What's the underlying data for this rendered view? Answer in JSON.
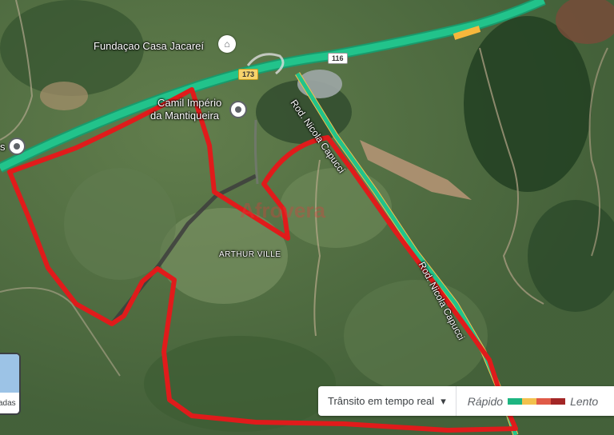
{
  "map": {
    "place_labels": {
      "fundacao": "Fundaçao Casa Jacareí",
      "camil_line1": "Camil Império",
      "camil_line2": "da Mantiqueira",
      "arthur": "ARTHUR VILLE",
      "left_edge": "s"
    },
    "road_labels": {
      "shield_116": "116",
      "shield_173": "173",
      "rod_upper": "Rod. Nicola Capucci",
      "rod_lower": "Rod. Nicola Capucci"
    },
    "watermark": "Afrovera"
  },
  "traffic": {
    "selector_label": "Trânsito em tempo real",
    "dropdown_icon": "▾",
    "fast_label": "Rápido",
    "slow_label": "Lento",
    "colors": [
      "#1db581",
      "#f2c14e",
      "#e05a47",
      "#a32626"
    ]
  },
  "layers": {
    "label": "adas"
  },
  "icons": {
    "pin": "location-pin-icon",
    "museum": "museum-icon"
  },
  "colors": {
    "highway": "#22c38b",
    "boundary": "#e01b1b"
  }
}
